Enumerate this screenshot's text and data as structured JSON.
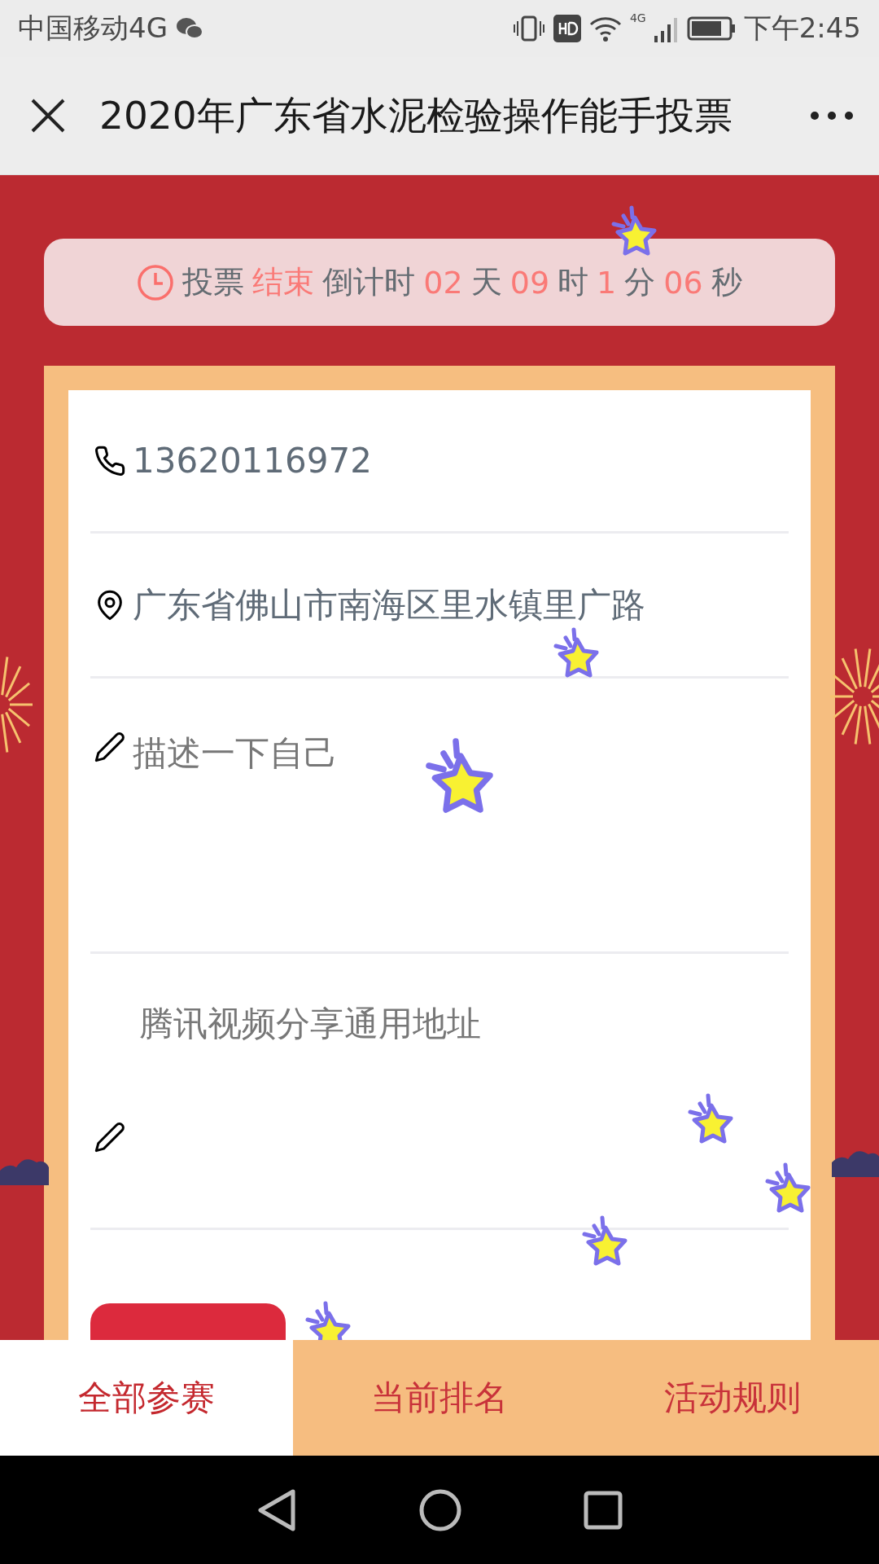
{
  "status_bar": {
    "carrier": "中国移动4G",
    "network": "4G",
    "time": "下午2:45"
  },
  "header": {
    "title": "2020年广东省水泥检验操作能手投票"
  },
  "countdown": {
    "parts": [
      {
        "text": "投票",
        "highlight": false
      },
      {
        "text": "结束",
        "highlight": true
      },
      {
        "text": "倒计时",
        "highlight": false
      },
      {
        "text": "02",
        "highlight": true
      },
      {
        "text": "天",
        "highlight": false
      },
      {
        "text": "09",
        "highlight": true
      },
      {
        "text": "时",
        "highlight": false
      },
      {
        "text": "1",
        "highlight": true
      },
      {
        "text": "分",
        "highlight": false
      },
      {
        "text": "06",
        "highlight": true
      },
      {
        "text": "秒",
        "highlight": false
      }
    ]
  },
  "form": {
    "fields": [
      {
        "kind": "phone",
        "value": "13620116972"
      },
      {
        "kind": "address",
        "value": "广东省佛山市南海区里水镇里广路"
      },
      {
        "kind": "description",
        "placeholder": "描述一下自己"
      },
      {
        "kind": "video",
        "placeholder": "腾讯视频分享通用地址"
      }
    ]
  },
  "tabs": [
    {
      "label": "全部参赛",
      "selected": true
    },
    {
      "label": "当前排名",
      "selected": false
    },
    {
      "label": "活动规则",
      "selected": false
    }
  ]
}
